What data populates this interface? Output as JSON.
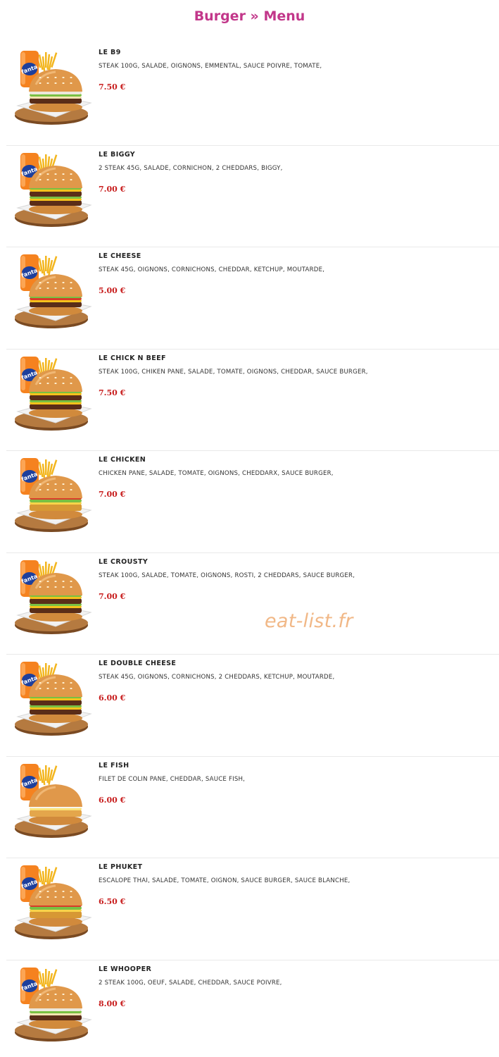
{
  "header": {
    "title": "Burger » Menu"
  },
  "watermark": "eat-list.fr",
  "can_label": "fanta",
  "colors": {
    "title": "#c2378a",
    "price": "#c81e1e",
    "can": "#f5821f"
  },
  "items": [
    {
      "name": "LE B9",
      "description": "STEAK 100G, SALADE, OIGNONS, EMMENTAL, SAUCE POIVRE, TOMATE,",
      "price": "7.50 €",
      "style": "sauce"
    },
    {
      "name": "LE BIGGY",
      "description": "2 STEAK 45G, SALADE, CORNICHON, 2 CHEDDARS, BIGGY,",
      "price": "7.00 €",
      "style": "double"
    },
    {
      "name": "LE CHEESE",
      "description": "STEAK 45G, OIGNONS, CORNICHONS, CHEDDAR, KETCHUP, MOUTARDE,",
      "price": "5.00 €",
      "style": "cheese"
    },
    {
      "name": "LE CHICK N BEEF",
      "description": "STEAK 100G, CHIKEN PANE, SALADE, TOMATE, OIGNONS, CHEDDAR, SAUCE BURGER,",
      "price": "7.50 €",
      "style": "double"
    },
    {
      "name": "LE CHICKEN",
      "description": "CHICKEN PANE, SALADE, TOMATE, OIGNONS, CHEDDARX, SAUCE BURGER,",
      "price": "7.00 €",
      "style": "chicken"
    },
    {
      "name": "LE CROUSTY",
      "description": "STEAK 100G, SALADE, TOMATE, OIGNONS, ROSTI, 2 CHEDDARS, SAUCE BURGER,",
      "price": "7.00 €",
      "style": "double"
    },
    {
      "name": "LE DOUBLE CHEESE",
      "description": "STEAK 45G, OIGNONS, CORNICHONS, 2 CHEDDARS, KETCHUP, MOUTARDE,",
      "price": "6.00 €",
      "style": "double"
    },
    {
      "name": "LE FISH",
      "description": "FILET DE COLIN PANE, CHEDDAR, SAUCE FISH,",
      "price": "6.00 €",
      "style": "fish"
    },
    {
      "name": "LE PHUKET",
      "description": "ESCALOPE THAI, SALADE, TOMATE, OIGNON, SAUCE BURGER, SAUCE BLANCHE,",
      "price": "6.50 €",
      "style": "chicken"
    },
    {
      "name": "LE WHOOPER",
      "description": "2 STEAK 100G, OEUF, SALADE, CHEDDAR, SAUCE POIVRE,",
      "price": "8.00 €",
      "style": "sauce"
    }
  ]
}
